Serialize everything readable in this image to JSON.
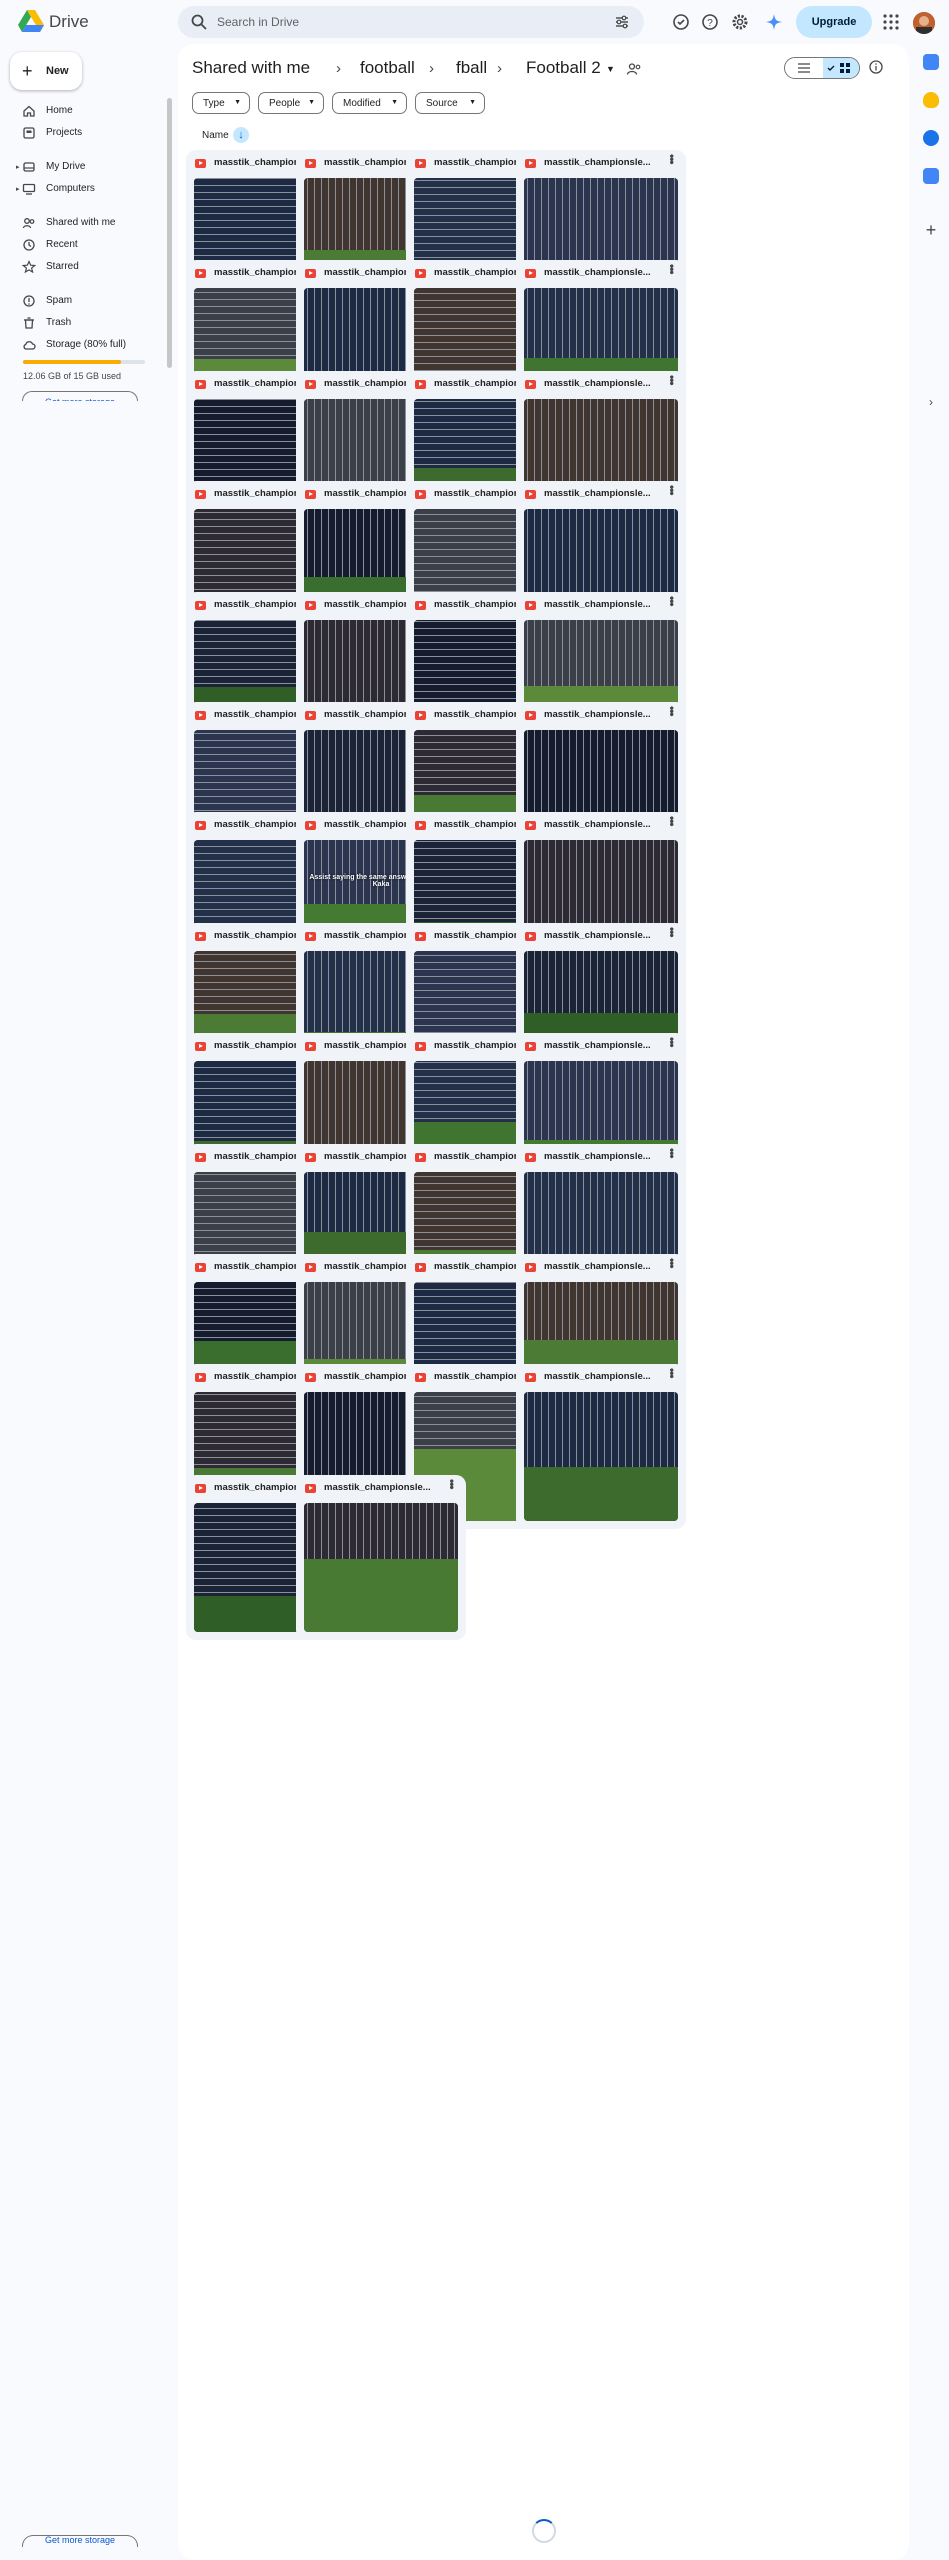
{
  "app": {
    "name": "Drive"
  },
  "search": {
    "placeholder": "Search in Drive"
  },
  "header": {
    "upgrade_label": "Upgrade"
  },
  "sidebar": {
    "new_label": "New",
    "items": [
      {
        "label": "Home",
        "icon": "home-icon"
      },
      {
        "label": "Projects",
        "icon": "projects-icon"
      },
      {
        "label": "My Drive",
        "icon": "my-drive-icon"
      },
      {
        "label": "Computers",
        "icon": "computers-icon"
      },
      {
        "label": "Shared with me",
        "icon": "shared-icon"
      },
      {
        "label": "Recent",
        "icon": "recent-icon"
      },
      {
        "label": "Starred",
        "icon": "star-icon"
      },
      {
        "label": "Spam",
        "icon": "spam-icon"
      },
      {
        "label": "Trash",
        "icon": "trash-icon"
      },
      {
        "label": "Storage (80% full)",
        "icon": "cloud-icon"
      }
    ],
    "storage_used_fraction": 0.8,
    "storage_text": "12.06 GB of 15 GB used",
    "get_storage_label": "Get more storage"
  },
  "breadcrumb": {
    "items": [
      "Shared with me",
      "football",
      "fball",
      "Football 2"
    ]
  },
  "filters": [
    "Type",
    "People",
    "Modified",
    "Source"
  ],
  "sort": {
    "label": "Name"
  },
  "files": [
    {
      "name": "masstik_championsle..."
    },
    {
      "name": "masstik_championsle..."
    },
    {
      "name": "masstik_championsle..."
    },
    {
      "name": "masstik_championsle..."
    },
    {
      "name": "masstik_championsle..."
    },
    {
      "name": "masstik_championsle..."
    },
    {
      "name": "masstik_championsle..."
    },
    {
      "name": "masstik_championsle..."
    },
    {
      "name": "masstik_championsle..."
    },
    {
      "name": "masstik_championsle..."
    },
    {
      "name": "masstik_championsle..."
    },
    {
      "name": "masstik_championsle..."
    },
    {
      "name": "masstik_championsle..."
    },
    {
      "name": "masstik_championsle..."
    },
    {
      "name": "masstik_championsle..."
    },
    {
      "name": "masstik_championsle..."
    },
    {
      "name": "masstik_championsle..."
    },
    {
      "name": "masstik_championsle..."
    },
    {
      "name": "masstik_championsle..."
    },
    {
      "name": "masstik_championsle..."
    },
    {
      "name": "masstik_championsle..."
    },
    {
      "name": "masstik_championsle..."
    },
    {
      "name": "masstik_championsle..."
    },
    {
      "name": "masstik_championsle..."
    },
    {
      "name": "masstik_championsle...",
      "caption": ""
    },
    {
      "name": "masstik_championsle...",
      "caption": "Assist saying the same answer with Elite & Kaka"
    },
    {
      "name": "masstik_championsle..."
    },
    {
      "name": "masstik_championsle..."
    },
    {
      "name": "masstik_championsle..."
    },
    {
      "name": "masstik_championsle..."
    },
    {
      "name": "masstik_championsle..."
    },
    {
      "name": "masstik_championsle..."
    },
    {
      "name": "masstik_championsle..."
    },
    {
      "name": "masstik_championsle..."
    },
    {
      "name": "masstik_championsle..."
    },
    {
      "name": "masstik_championsle..."
    },
    {
      "name": "masstik_championsle..."
    },
    {
      "name": "masstik_championsle..."
    },
    {
      "name": "masstik_championsle..."
    },
    {
      "name": "masstik_championsle..."
    },
    {
      "name": "masstik_championsle..."
    },
    {
      "name": "masstik_championsle..."
    },
    {
      "name": "masstik_championsle..."
    },
    {
      "name": "masstik_championsle..."
    },
    {
      "name": "masstik_championsle..."
    },
    {
      "name": "masstik_championsle..."
    },
    {
      "name": "masstik_championsle..."
    },
    {
      "name": "masstik_championsle..."
    },
    {
      "name": "masstik_championsle..."
    },
    {
      "name": "masstik_championsle..."
    }
  ]
}
